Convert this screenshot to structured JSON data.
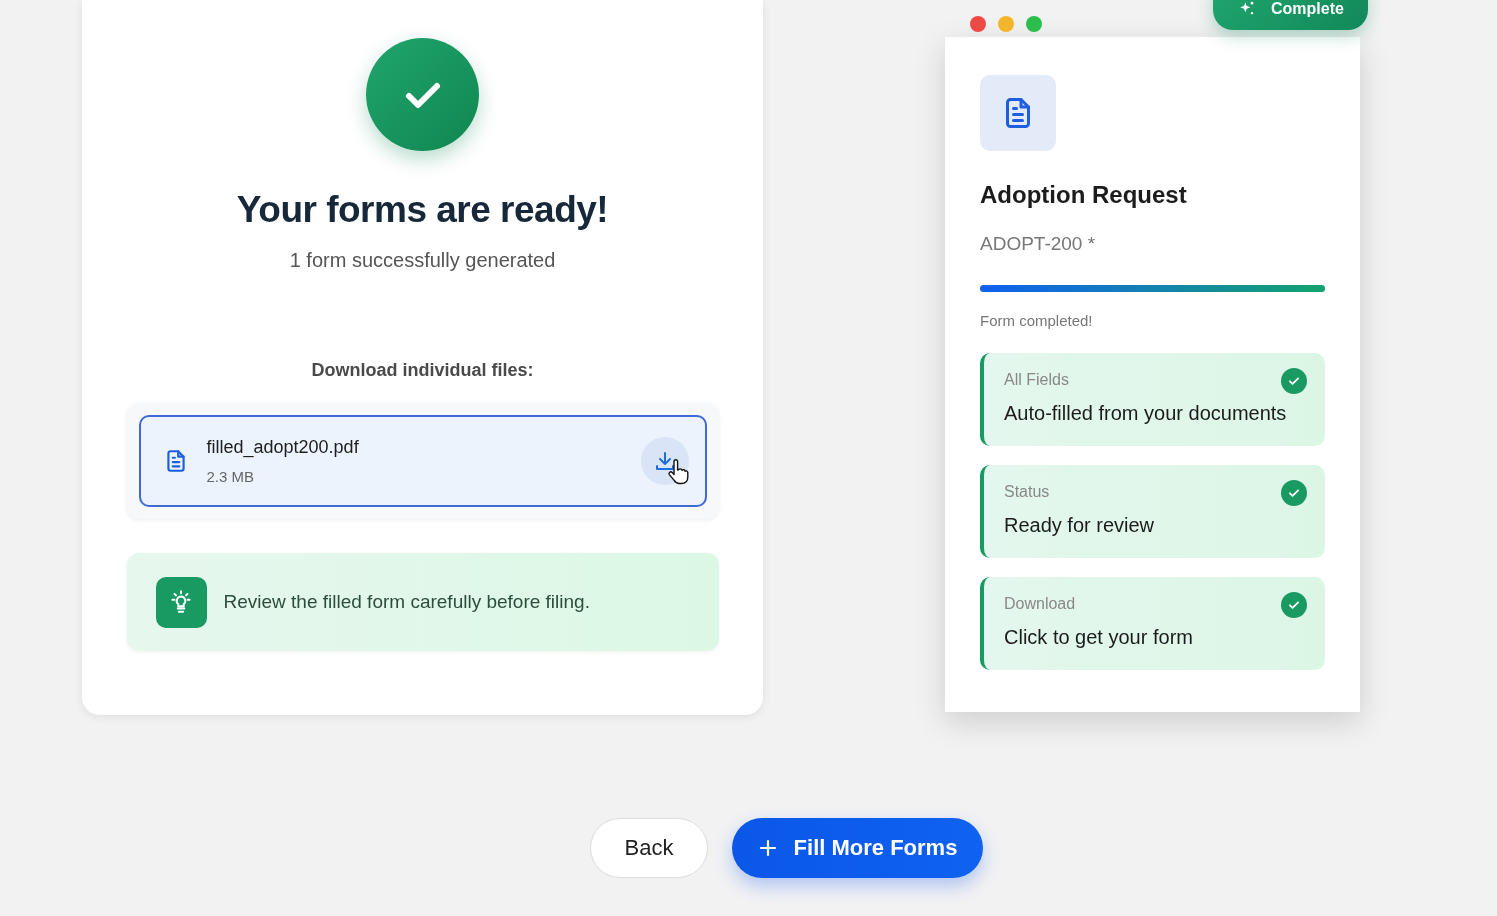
{
  "success": {
    "title": "Your forms are ready!",
    "subtitle": "1 form successfully generated"
  },
  "downloads": {
    "heading": "Download individual files:",
    "files": [
      {
        "name": "filled_adopt200.pdf",
        "size": "2.3 MB",
        "selected": true
      }
    ]
  },
  "tip": "Review the filled form carefully before filing.",
  "preview": {
    "badge": "Complete",
    "title": "Adoption Request",
    "code": "ADOPT-200 *",
    "progress": {
      "level": 1,
      "caption": "Form completed!"
    },
    "items": [
      {
        "label": "All Fields",
        "value": "Auto-filled from your documents",
        "checked": true
      },
      {
        "label": "Status",
        "value": "Ready for review",
        "checked": true
      },
      {
        "label": "Download",
        "value": "Click to get your form",
        "checked": true
      }
    ]
  },
  "buttons": {
    "back": "Back",
    "primary": "Fill More Forms"
  }
}
